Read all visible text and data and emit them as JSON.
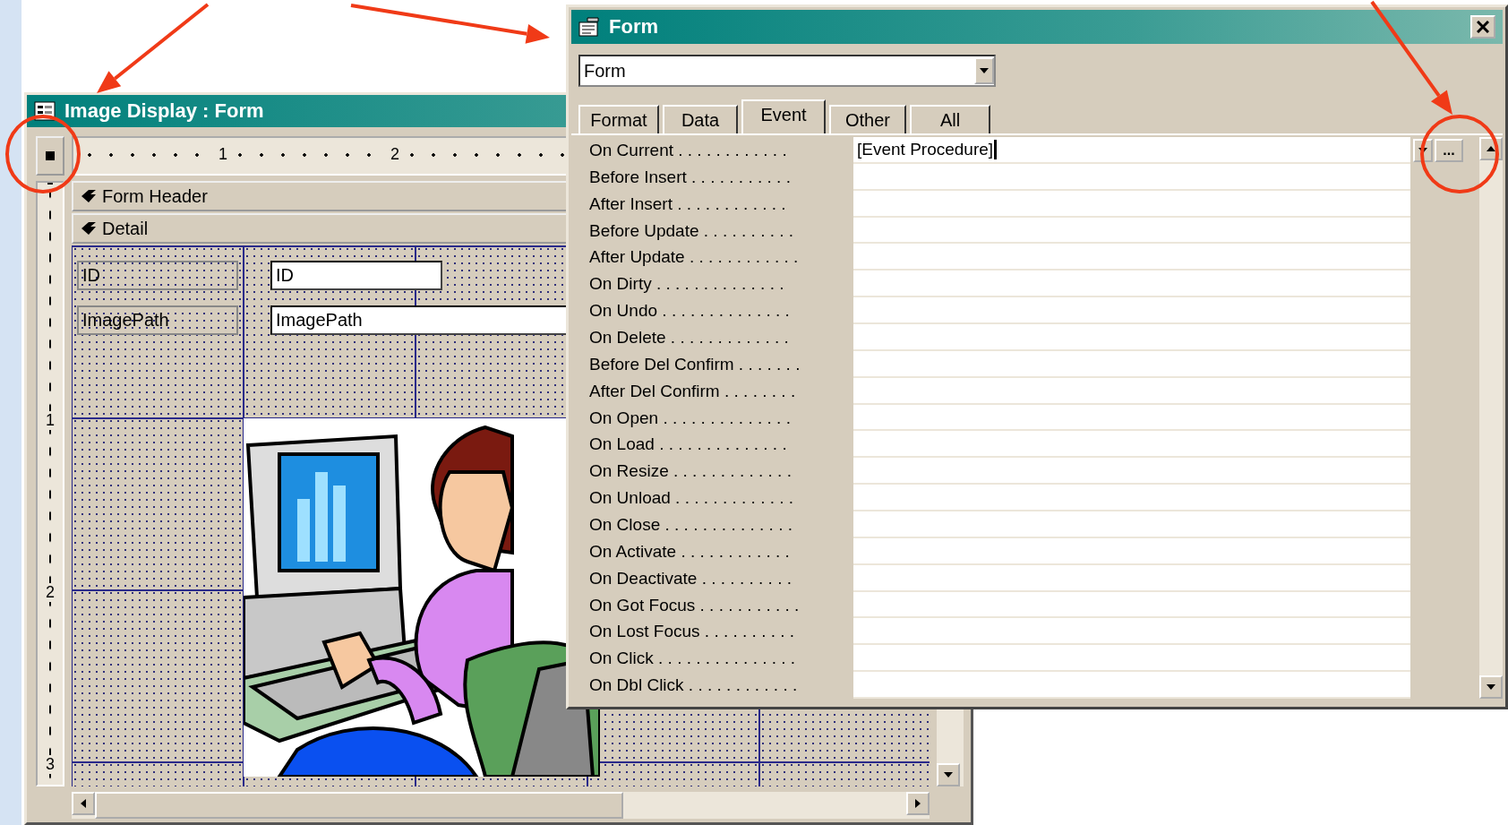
{
  "design_window": {
    "title": "Image Display : Form",
    "ruler_marks": [
      "1",
      "2"
    ],
    "vertical_ruler_marks": [
      "1",
      "2",
      "3"
    ],
    "sections": [
      "Form Header",
      "Detail"
    ],
    "controls": [
      {
        "label": "ID",
        "field": "ID"
      },
      {
        "label": "ImagePath",
        "field": "ImagePath"
      }
    ]
  },
  "property_sheet": {
    "title": "Form",
    "object_selector": "Form",
    "build_button": "...",
    "tabs": [
      {
        "label": "Format",
        "selected": false
      },
      {
        "label": "Data",
        "selected": false
      },
      {
        "label": "Event",
        "selected": true
      },
      {
        "label": "Other",
        "selected": false
      },
      {
        "label": "All",
        "selected": false
      }
    ],
    "properties": [
      {
        "name": "On Current . . . . . . . . . . . .",
        "value": "[Event Procedure]",
        "selected": true
      },
      {
        "name": "Before Insert . . . . . . . . . . .",
        "selected": false
      },
      {
        "name": "After Insert . . . . . . . . . . . .",
        "selected": false
      },
      {
        "name": "Before Update . . . . . . . . . .",
        "selected": false
      },
      {
        "name": "After Update . . . . . . . . . . . .",
        "selected": false
      },
      {
        "name": "On Dirty . . . . . . . . . . . . . .",
        "selected": false
      },
      {
        "name": "On Undo . . . . . . . . . . . . . .",
        "selected": false
      },
      {
        "name": "On Delete . . . . . . . . . . . . .",
        "selected": false
      },
      {
        "name": "Before Del Confirm . . . . . . .",
        "selected": false
      },
      {
        "name": "After Del Confirm . . . . . . . .",
        "selected": false
      },
      {
        "name": "On Open . . . . . . . . . . . . . .",
        "selected": false
      },
      {
        "name": "On Load . . . . . . . . . . . . . .",
        "selected": false
      },
      {
        "name": "On Resize . . . . . . . . . . . . .",
        "selected": false
      },
      {
        "name": "On Unload . . . . . . . . . . . . .",
        "selected": false
      },
      {
        "name": "On Close . . . . . . . . . . . . . .",
        "selected": false
      },
      {
        "name": "On Activate . . . . . . . . . . . .",
        "selected": false
      },
      {
        "name": "On Deactivate . . . . . . . . . .",
        "selected": false
      },
      {
        "name": "On Got Focus . . . . . . . . . . .",
        "selected": false
      },
      {
        "name": "On Lost Focus . . . . . . . . . .",
        "selected": false
      },
      {
        "name": "On Click . . . . . . . . . . . . . . .",
        "selected": false
      },
      {
        "name": "On Dbl Click . . . . . . . . . . . .",
        "selected": false
      }
    ]
  }
}
